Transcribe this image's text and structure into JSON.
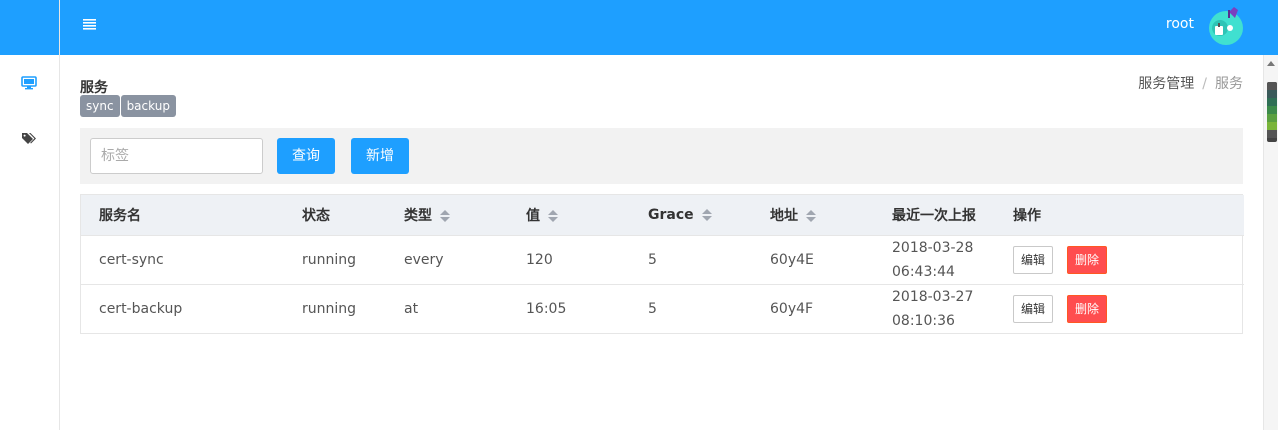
{
  "header": {
    "user_name": "root"
  },
  "sidebar": {
    "items": [
      {
        "icon": "monitor-icon",
        "active": true
      },
      {
        "icon": "tags-icon",
        "active": false
      }
    ]
  },
  "page": {
    "title": "服务",
    "tags": [
      "sync",
      "backup"
    ]
  },
  "breadcrumb": {
    "parent": "服务管理",
    "separator": "/",
    "current": "服务"
  },
  "toolbar": {
    "tag_placeholder": "标签",
    "tag_value": "",
    "query_label": "查询",
    "add_label": "新增"
  },
  "table": {
    "columns": [
      "服务名",
      "状态",
      "类型",
      "值",
      "Grace",
      "地址",
      "最近一次上报",
      "操作"
    ],
    "sortable": [
      false,
      false,
      true,
      true,
      true,
      true,
      false,
      false
    ],
    "rows": [
      {
        "name": "cert-sync",
        "status": "running",
        "type": "every",
        "value": "120",
        "grace": "5",
        "address": "60y4E",
        "report_date": "2018-03-28",
        "report_time": "06:43:44"
      },
      {
        "name": "cert-backup",
        "status": "running",
        "type": "at",
        "value": "16:05",
        "grace": "5",
        "address": "60y4F",
        "report_date": "2018-03-27",
        "report_time": "08:10:36"
      }
    ],
    "edit_label": "编辑",
    "delete_label": "删除"
  },
  "colors": {
    "primary": "#1e9fff",
    "danger": "#ff4d4f",
    "tag_bg": "#8a93a1",
    "table_header_bg": "#eef1f5",
    "toolbar_bg": "#f2f2f2"
  }
}
